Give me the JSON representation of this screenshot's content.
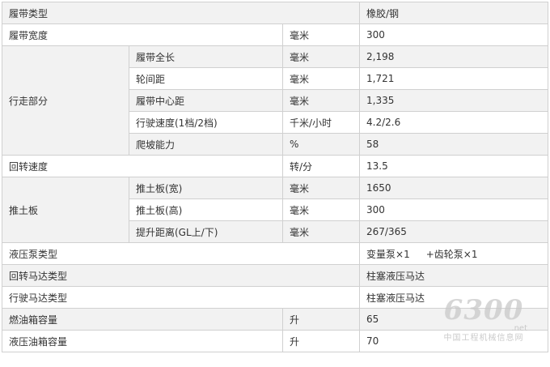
{
  "rows": {
    "track_type": {
      "label": "履带类型",
      "value": "橡胶/钢"
    },
    "track_width": {
      "label": "履带宽度",
      "unit": "毫米",
      "value": "300"
    },
    "travel": {
      "group_label": "行走部分",
      "items": [
        {
          "label": "履带全长",
          "unit": "毫米",
          "value": "2,198"
        },
        {
          "label": "轮间距",
          "unit": "毫米",
          "value": "1,721"
        },
        {
          "label": "履带中心距",
          "unit": "毫米",
          "value": "1,335"
        },
        {
          "label": "行驶速度(1档/2档)",
          "unit": "千米/小时",
          "value": "4.2/2.6"
        },
        {
          "label": "爬坡能力",
          "unit": "%",
          "value": "58"
        }
      ]
    },
    "swing_speed": {
      "label": "回转速度",
      "unit": "转/分",
      "value": "13.5"
    },
    "blade": {
      "group_label": "推土板",
      "items": [
        {
          "label": "推土板(宽)",
          "unit": "毫米",
          "value": "1650"
        },
        {
          "label": "推土板(高)",
          "unit": "毫米",
          "value": "300"
        },
        {
          "label": "提升距离(GL上/下)",
          "unit": "毫米",
          "value": "267/365"
        }
      ]
    },
    "pump_type": {
      "label": "液压泵类型",
      "value_a": "变量泵×1",
      "value_b": "+齿轮泵×1"
    },
    "swing_motor": {
      "label": "回转马达类型",
      "value": "柱塞液压马达"
    },
    "travel_motor": {
      "label": "行驶马达类型",
      "value": "柱塞液压马达"
    },
    "fuel_tank": {
      "label": "燃油箱容量",
      "unit": "升",
      "value": "65"
    },
    "hydraulic_tank": {
      "label": "液压油箱容量",
      "unit": "升",
      "value": "70"
    }
  },
  "watermark": {
    "number": "6300",
    "domain": ".net",
    "cn": "中国工程机械信息网"
  }
}
